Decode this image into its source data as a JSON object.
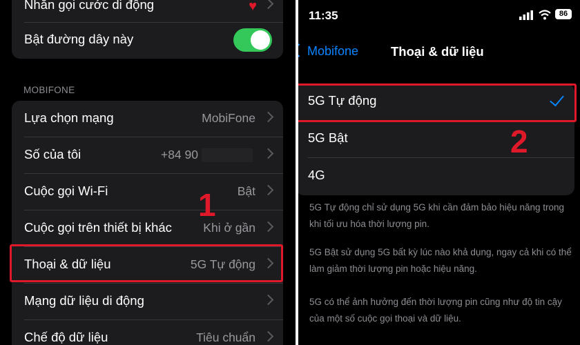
{
  "left": {
    "top_group": {
      "rows": [
        {
          "label": "Nhắn gọi cước di động"
        },
        {
          "label": "Bật đường dây này"
        }
      ],
      "heart_color": "#e0192a",
      "toggle_color": "#34c759"
    },
    "section_header": "MOBIFONE",
    "rows": [
      {
        "label": "Lựa chọn mạng",
        "value": "MobiFone"
      },
      {
        "label": "Số của tôi",
        "value": "+84 90"
      },
      {
        "label": "Cuộc gọi Wi-Fi",
        "value": "Bật"
      },
      {
        "label": "Cuộc gọi trên thiết bị khác",
        "value": "Khi ở gần"
      },
      {
        "label": "Thoại & dữ liệu",
        "value": "5G Tự động"
      },
      {
        "label": "Mạng dữ liệu di động",
        "value": ""
      },
      {
        "label": "Chế độ dữ liệu",
        "value": "Tiêu chuẩn"
      }
    ],
    "marker": "1"
  },
  "right": {
    "status": {
      "time": "11:35",
      "battery": "86",
      "icons": [
        "signal-icon",
        "wifi-icon",
        "battery-icon"
      ]
    },
    "nav": {
      "back_label": "Mobifone",
      "title": "Thoại & dữ liệu"
    },
    "options": [
      {
        "label": "5G Tự động",
        "selected": true
      },
      {
        "label": "5G Bật",
        "selected": false
      },
      {
        "label": "4G",
        "selected": false
      }
    ],
    "marker": "2",
    "footnotes": [
      "5G Tự động chỉ sử dụng 5G khi cần đảm bảo hiệu năng trong khi tối ưu hóa thời lượng pin.",
      "5G Bật sử dụng 5G bất kỳ lúc nào khả dụng, ngay cả khi có thể làm giảm thời lượng pin hoặc hiệu năng.",
      "5G có thể ảnh hưởng đến thời lượng pin cũng như độ tin cậy của một số cuộc gọi thoại và dữ liệu."
    ]
  },
  "colors": {
    "accent": "#0a84ff",
    "highlight": "#e0192a",
    "background": "#000000",
    "cell": "#1c1c1e"
  }
}
